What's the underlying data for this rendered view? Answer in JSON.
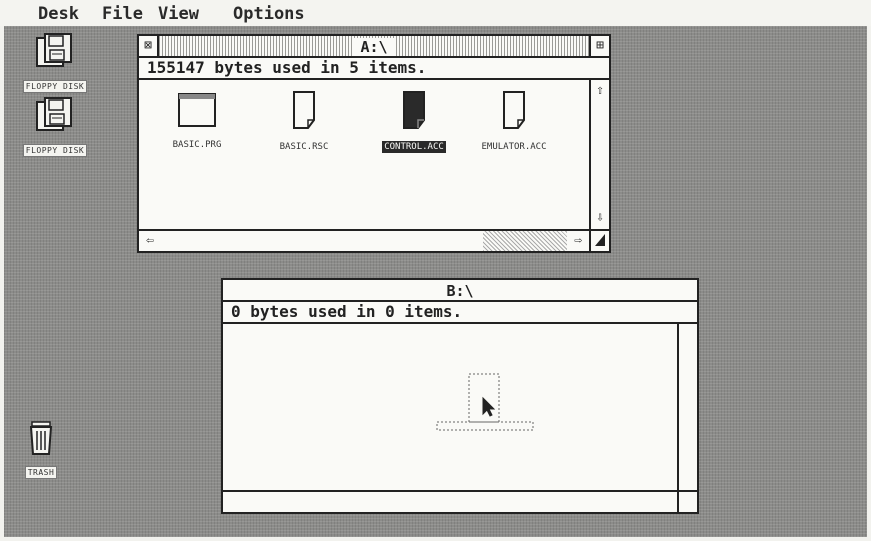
{
  "menubar": {
    "items": [
      "Desk",
      "File",
      "View",
      "Options"
    ]
  },
  "desktop_icons": {
    "floppy_a": "FLOPPY DISK",
    "floppy_b": "FLOPPY DISK",
    "trash": "TRASH"
  },
  "window_a": {
    "title": "A:\\",
    "info": "155147 bytes used in 5 items.",
    "files": [
      {
        "name": "BASIC.PRG",
        "icon": "program-icon",
        "selected": false
      },
      {
        "name": "BASIC.RSC",
        "icon": "document-icon",
        "selected": false
      },
      {
        "name": "CONTROL.ACC",
        "icon": "document-icon",
        "selected": true
      },
      {
        "name": "EMULATOR.ACC",
        "icon": "document-icon",
        "selected": false
      }
    ]
  },
  "window_b": {
    "title": "B:\\",
    "info": "0 bytes used in 0 items."
  },
  "colors": {
    "desktop": "#8c8c8a",
    "window": "#fafaf7",
    "ink": "#222222"
  }
}
